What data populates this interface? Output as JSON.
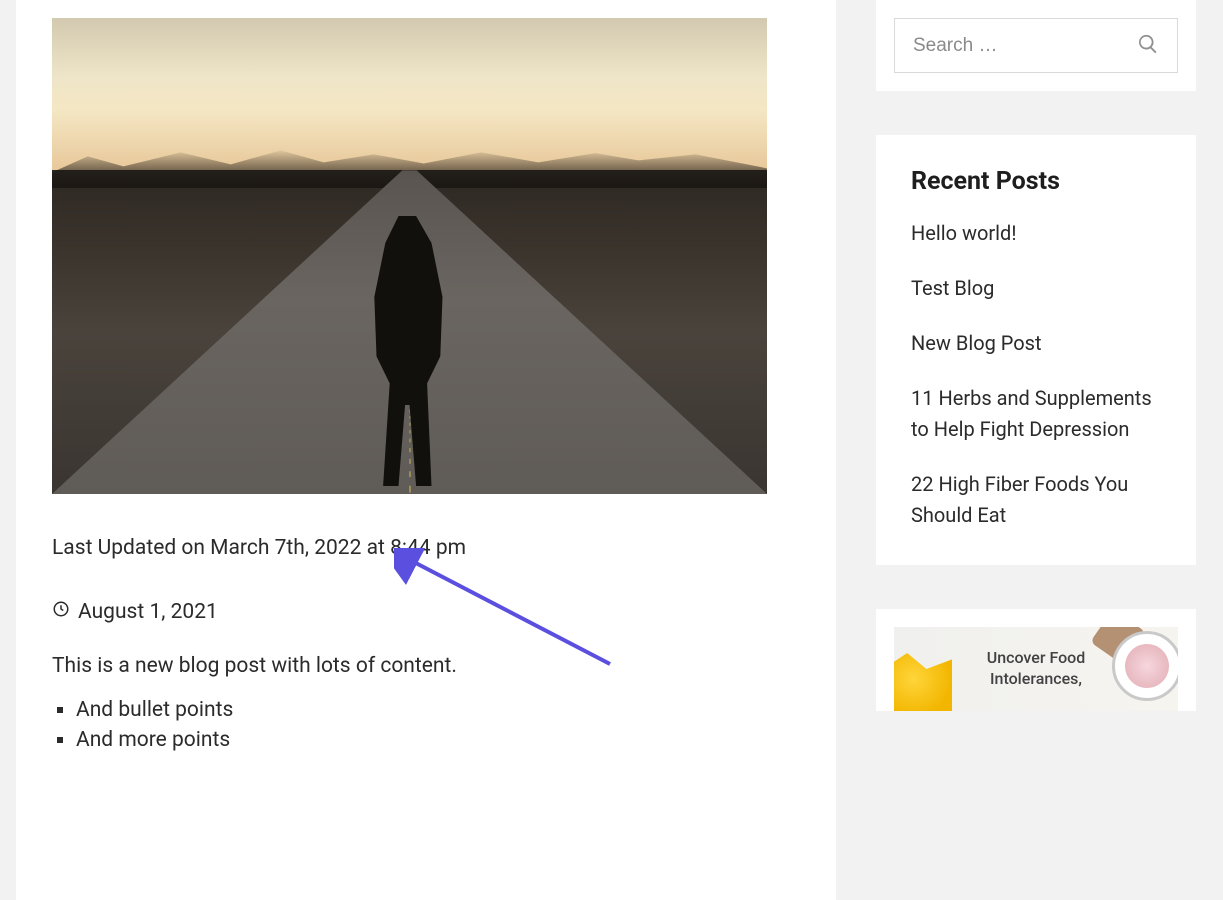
{
  "post": {
    "last_updated": "Last Updated on March 7th, 2022 at 8:44 pm",
    "published_date": "August 1, 2021",
    "intro": "This is a new blog post with lots of content.",
    "bullets": [
      "And bullet points",
      "And more points"
    ]
  },
  "sidebar": {
    "search_placeholder": "Search …",
    "recent_heading": "Recent Posts",
    "recent_posts": [
      "Hello world!",
      "Test Blog",
      "New Blog Post",
      "11 Herbs and Supplements to Help Fight Depression",
      "22 High Fiber Foods You Should Eat"
    ],
    "ad_text": "Uncover Food Intolerances,"
  }
}
